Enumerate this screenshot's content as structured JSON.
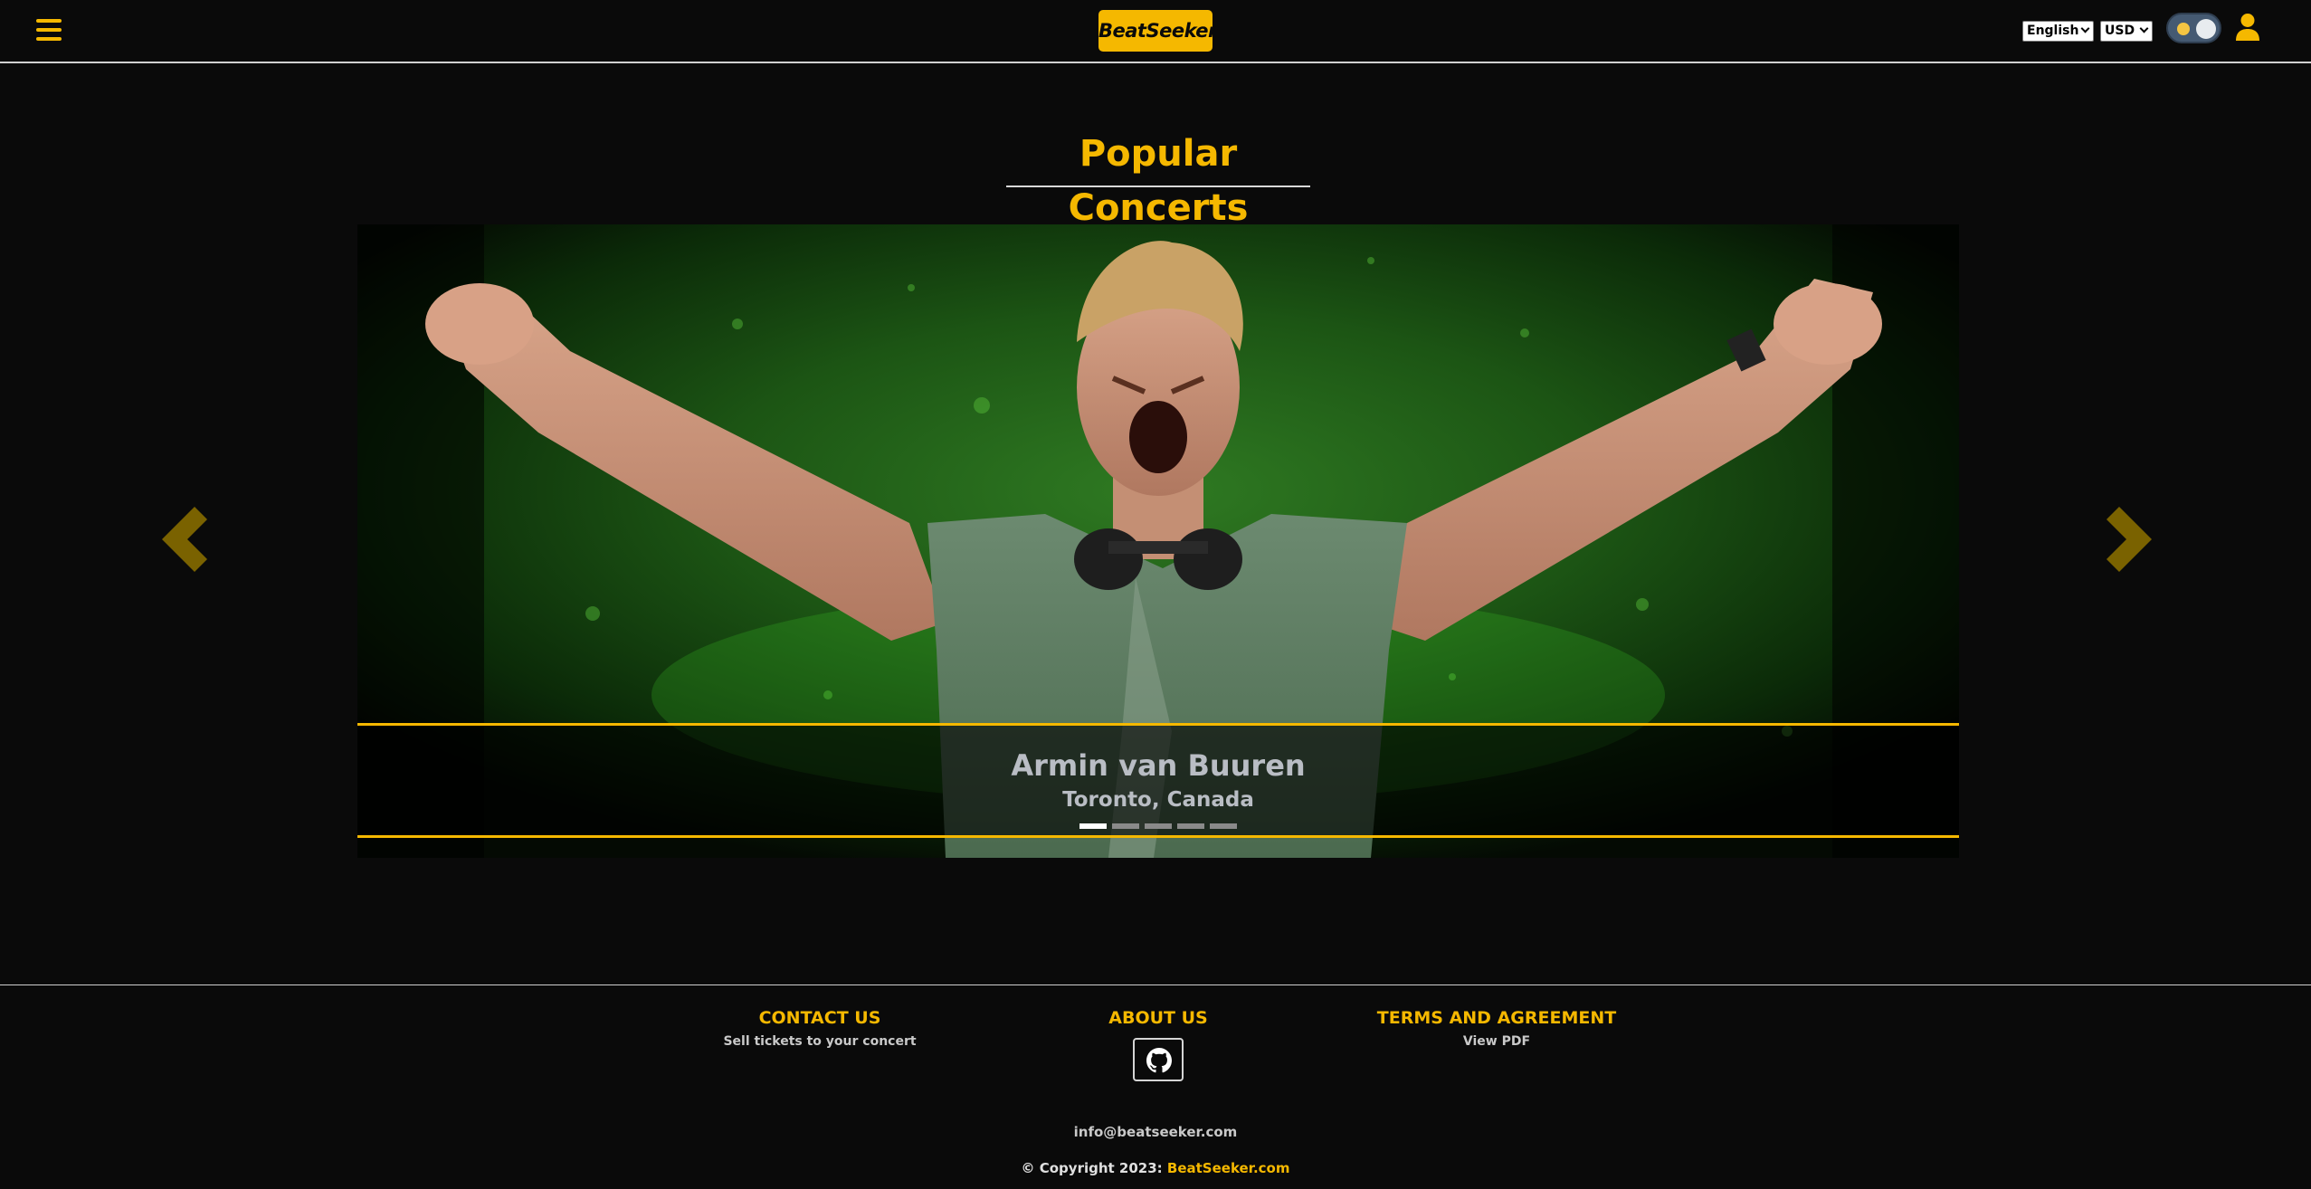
{
  "header": {
    "logo_text": "BeatSeeker",
    "language": "English",
    "currency": "USD"
  },
  "main": {
    "title": "Popular Concerts",
    "carousel": {
      "slide": {
        "artist": "Armin van Buuren",
        "location": "Toronto, Canada"
      },
      "total_slides": 5,
      "active_slide": 1
    }
  },
  "footer": {
    "contact": {
      "heading": "CONTACT US",
      "link": "Sell tickets to your concert"
    },
    "about": {
      "heading": "ABOUT US"
    },
    "terms": {
      "heading": "TERMS AND AGREEMENT",
      "link": "View PDF"
    },
    "email": "info@beatseeker.com",
    "copyright_prefix": "© Copyright 2023: ",
    "copyright_brand": "BeatSeeker.com"
  },
  "colors": {
    "accent": "#f5b800",
    "background": "#0a0a0a",
    "caption_text": "#b9bdc4"
  },
  "icons": [
    "hamburger-menu-icon",
    "theme-toggle",
    "user-icon",
    "chevron-left-icon",
    "chevron-right-icon",
    "github-icon"
  ]
}
